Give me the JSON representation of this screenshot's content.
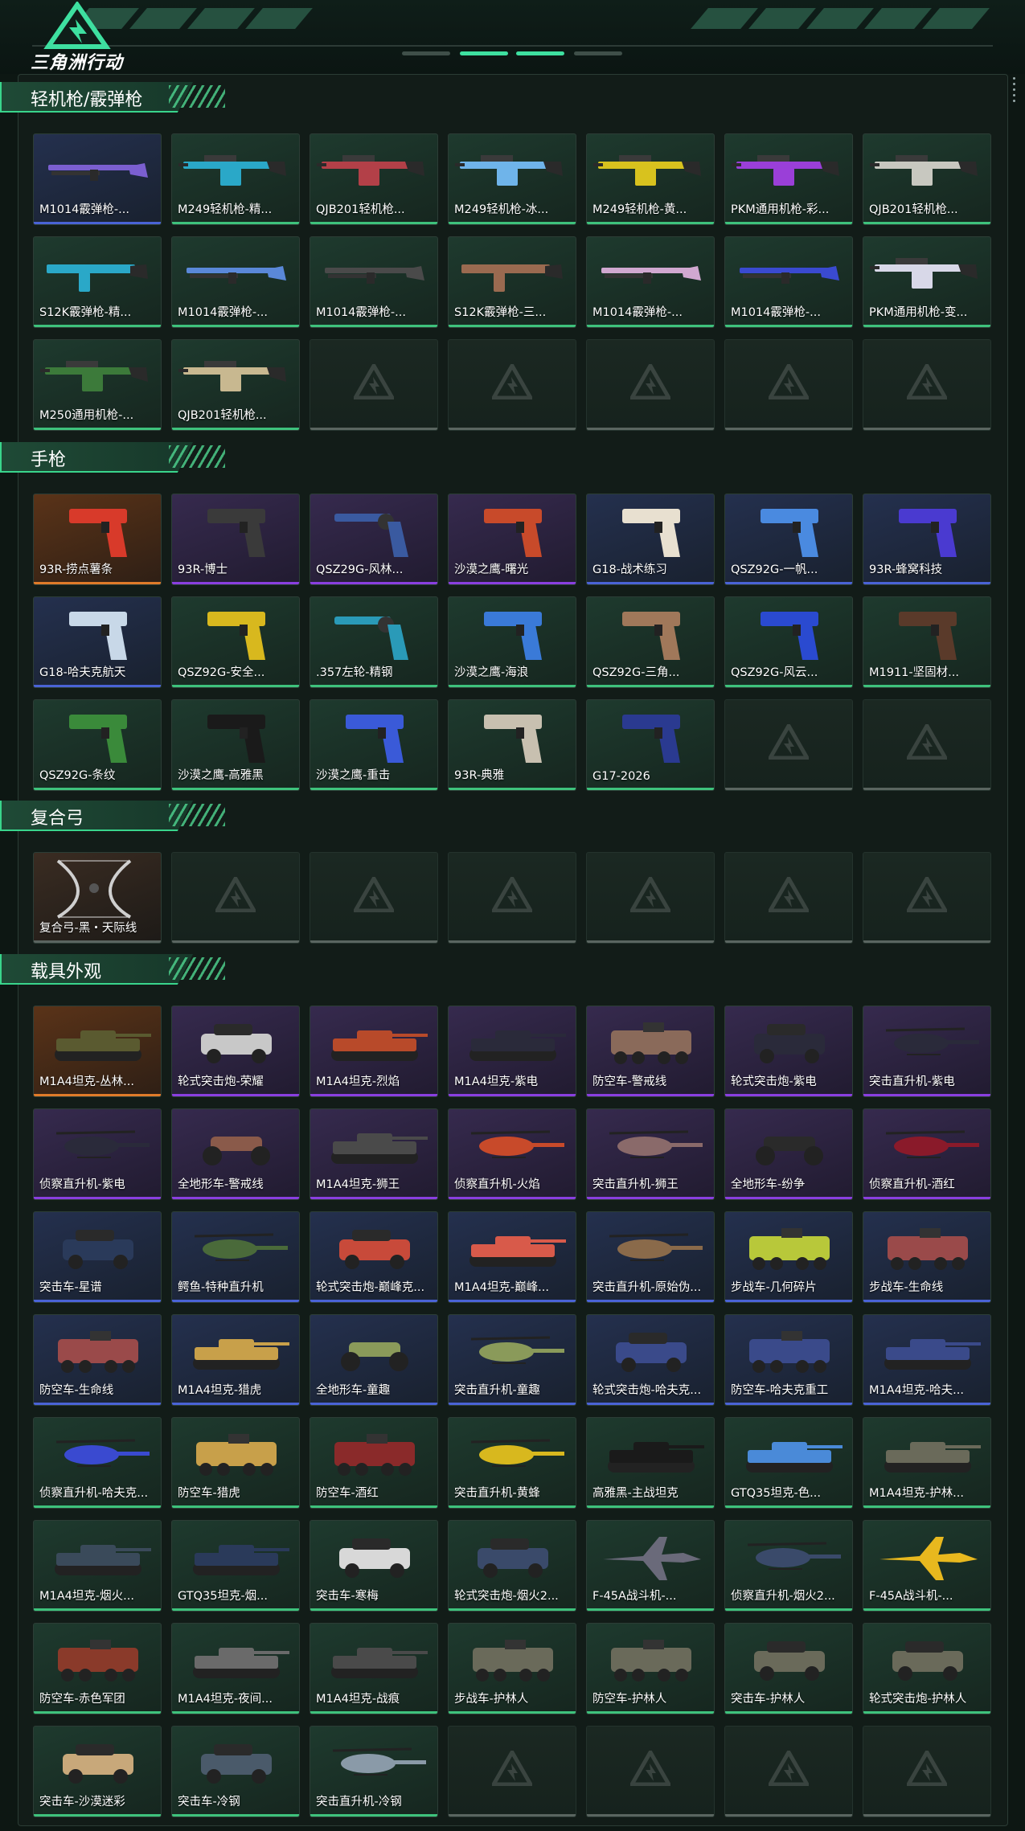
{
  "app": {
    "logo_text": "三角洲行动"
  },
  "theme": {
    "green": "#3ec27c",
    "blue": "#4a63d6",
    "purple": "#8a3fe0",
    "orange": "#e07b2a",
    "empty": "#5a6560"
  },
  "sections": [
    {
      "title": "轻机枪/霰弹枪",
      "items": [
        {
          "label": "M1014霰弹枪-...",
          "rarity": "blue",
          "type": "shotgun",
          "color": "#7b5fd0"
        },
        {
          "label": "M249轻机枪-精...",
          "rarity": "green",
          "type": "lmg",
          "color": "#2aa8c8"
        },
        {
          "label": "QJB201轻机枪...",
          "rarity": "green",
          "type": "lmg",
          "color": "#b34048"
        },
        {
          "label": "M249轻机枪-冰...",
          "rarity": "green",
          "type": "lmg",
          "color": "#6fb4ea"
        },
        {
          "label": "M249轻机枪-黄...",
          "rarity": "green",
          "type": "lmg",
          "color": "#d8c21e"
        },
        {
          "label": "PKM通用机枪-彩...",
          "rarity": "green",
          "type": "lmg",
          "color": "#9a3fd8"
        },
        {
          "label": "QJB201轻机枪...",
          "rarity": "green",
          "type": "lmg",
          "color": "#c8c8c0"
        },
        {
          "label": "S12K霰弹枪-精...",
          "rarity": "green",
          "type": "rifle",
          "color": "#2aa8c8"
        },
        {
          "label": "M1014霰弹枪-...",
          "rarity": "green",
          "type": "shotgun",
          "color": "#5a88d8"
        },
        {
          "label": "M1014霰弹枪-...",
          "rarity": "green",
          "type": "shotgun",
          "color": "#4a4a4a"
        },
        {
          "label": "S12K霰弹枪-三...",
          "rarity": "green",
          "type": "rifle",
          "color": "#9a6a50"
        },
        {
          "label": "M1014霰弹枪-...",
          "rarity": "green",
          "type": "shotgun",
          "color": "#d0a8d0"
        },
        {
          "label": "M1014霰弹枪-...",
          "rarity": "green",
          "type": "shotgun",
          "color": "#3a4ad0"
        },
        {
          "label": "PKM通用机枪-变...",
          "rarity": "green",
          "type": "lmg",
          "color": "#d8d8e8"
        },
        {
          "label": "M250通用机枪-...",
          "rarity": "green",
          "type": "lmg",
          "color": "#3c7a3a"
        },
        {
          "label": "QJB201轻机枪...",
          "rarity": "green",
          "type": "lmg",
          "color": "#c8b890"
        },
        {
          "empty": true
        },
        {
          "empty": true
        },
        {
          "empty": true
        },
        {
          "empty": true
        },
        {
          "empty": true
        }
      ]
    },
    {
      "title": "手枪",
      "items": [
        {
          "label": "93R-捞点薯条",
          "rarity": "orange",
          "type": "pistol",
          "color": "#d83a2a"
        },
        {
          "label": "93R-博士",
          "rarity": "purple",
          "type": "pistol",
          "color": "#3a3a3a"
        },
        {
          "label": "QSZ29G-风林...",
          "rarity": "purple",
          "type": "revolver",
          "color": "#3a5aa0"
        },
        {
          "label": "沙漠之鹰-曙光",
          "rarity": "purple",
          "type": "pistol",
          "color": "#c84a2a"
        },
        {
          "label": "G18-战术练习",
          "rarity": "blue",
          "type": "pistol",
          "color": "#e8e0d0"
        },
        {
          "label": "QSZ92G-一帆...",
          "rarity": "blue",
          "type": "pistol",
          "color": "#4a8ae0"
        },
        {
          "label": "93R-蜂窝科技",
          "rarity": "blue",
          "type": "pistol",
          "color": "#4a3ad0"
        },
        {
          "label": "G18-哈夫克航天",
          "rarity": "blue",
          "type": "pistol",
          "color": "#c8d8e8"
        },
        {
          "label": "QSZ92G-安全...",
          "rarity": "green",
          "type": "pistol",
          "color": "#d8b81e"
        },
        {
          "label": ".357左轮-精钢",
          "rarity": "green",
          "type": "revolver",
          "color": "#2a9ab8"
        },
        {
          "label": "沙漠之鹰-海浪",
          "rarity": "green",
          "type": "pistol",
          "color": "#3a7ad8"
        },
        {
          "label": "QSZ92G-三角...",
          "rarity": "green",
          "type": "pistol",
          "color": "#a0785a"
        },
        {
          "label": "QSZ92G-风云...",
          "rarity": "green",
          "type": "pistol",
          "color": "#2a4ad0"
        },
        {
          "label": "M1911-坚固材...",
          "rarity": "green",
          "type": "pistol",
          "color": "#5a3a2a"
        },
        {
          "label": "QSZ92G-条纹",
          "rarity": "green",
          "type": "pistol",
          "color": "#3a8a3a"
        },
        {
          "label": "沙漠之鹰-高雅黑",
          "rarity": "green",
          "type": "pistol",
          "color": "#1a1a1a"
        },
        {
          "label": "沙漠之鹰-重击",
          "rarity": "green",
          "type": "pistol",
          "color": "#3a5ad8"
        },
        {
          "label": "93R-典雅",
          "rarity": "green",
          "type": "pistol",
          "color": "#c8c0b0"
        },
        {
          "label": "G17-2026",
          "rarity": "green",
          "type": "pistol",
          "color": "#2a3a90"
        },
        {
          "empty": true
        },
        {
          "empty": true
        }
      ]
    },
    {
      "title": "复合弓",
      "items": [
        {
          "label": "复合弓-黑・天际线",
          "rarity": "empty",
          "type": "bow",
          "color": "#cfcfcf"
        },
        {
          "empty": true
        },
        {
          "empty": true
        },
        {
          "empty": true
        },
        {
          "empty": true
        },
        {
          "empty": true
        },
        {
          "empty": true
        }
      ]
    },
    {
      "title": "载具外观",
      "items": [
        {
          "label": "M1A4坦克-丛林...",
          "rarity": "orange",
          "type": "tank",
          "color": "#5a5a30"
        },
        {
          "label": "轮式突击炮-荣耀",
          "rarity": "purple",
          "type": "car",
          "color": "#c8c8c8"
        },
        {
          "label": "M1A4坦克-烈焰",
          "rarity": "purple",
          "type": "tank",
          "color": "#b84a2a"
        },
        {
          "label": "M1A4坦克-紫电",
          "rarity": "purple",
          "type": "tank",
          "color": "#2a2a3a"
        },
        {
          "label": "防空车-警戒线",
          "rarity": "purple",
          "type": "apc",
          "color": "#8a6a5a"
        },
        {
          "label": "轮式突击炮-紫电",
          "rarity": "purple",
          "type": "car",
          "color": "#2a2a3a"
        },
        {
          "label": "突击直升机-紫电",
          "rarity": "purple",
          "type": "heli",
          "color": "#2a2a3a"
        },
        {
          "label": "侦察直升机-紫电",
          "rarity": "purple",
          "type": "heli",
          "color": "#2a2a3a"
        },
        {
          "label": "全地形车-警戒线",
          "rarity": "purple",
          "type": "atv",
          "color": "#8a5a4a"
        },
        {
          "label": "M1A4坦克-狮王",
          "rarity": "purple",
          "type": "tank",
          "color": "#4a4a4a"
        },
        {
          "label": "侦察直升机-火焰",
          "rarity": "purple",
          "type": "heli",
          "color": "#c84a2a"
        },
        {
          "label": "突击直升机-狮王",
          "rarity": "purple",
          "type": "heli",
          "color": "#8a6a6a"
        },
        {
          "label": "全地形车-纷争",
          "rarity": "purple",
          "type": "atv",
          "color": "#2a2a2a"
        },
        {
          "label": "侦察直升机-酒红",
          "rarity": "purple",
          "type": "heli",
          "color": "#8a1a2a"
        },
        {
          "label": "突击车-星谱",
          "rarity": "blue",
          "type": "car",
          "color": "#2a3a5a"
        },
        {
          "label": "鳄鱼-特种直升机",
          "rarity": "blue",
          "type": "heli",
          "color": "#4a6a3a"
        },
        {
          "label": "轮式突击炮-巅峰克...",
          "rarity": "blue",
          "type": "car",
          "color": "#c84a3a"
        },
        {
          "label": "M1A4坦克-巅峰...",
          "rarity": "blue",
          "type": "tank",
          "color": "#d85a4a"
        },
        {
          "label": "突击直升机-原始伪...",
          "rarity": "blue",
          "type": "heli",
          "color": "#8a6a4a"
        },
        {
          "label": "步战车-几何碎片",
          "rarity": "blue",
          "type": "apc",
          "color": "#b8c83a"
        },
        {
          "label": "步战车-生命线",
          "rarity": "blue",
          "type": "apc",
          "color": "#9a4a4a"
        },
        {
          "label": "防空车-生命线",
          "rarity": "blue",
          "type": "apc",
          "color": "#9a4a4a"
        },
        {
          "label": "M1A4坦克-猎虎",
          "rarity": "blue",
          "type": "tank",
          "color": "#c8a04a"
        },
        {
          "label": "全地形车-童趣",
          "rarity": "blue",
          "type": "atv",
          "color": "#8a9a5a"
        },
        {
          "label": "突击直升机-童趣",
          "rarity": "blue",
          "type": "heli",
          "color": "#8a9a5a"
        },
        {
          "label": "轮式突击炮-哈夫克...",
          "rarity": "blue",
          "type": "car",
          "color": "#3a4a8a"
        },
        {
          "label": "防空车-哈夫克重工",
          "rarity": "blue",
          "type": "apc",
          "color": "#3a4a8a"
        },
        {
          "label": "M1A4坦克-哈夫...",
          "rarity": "blue",
          "type": "tank",
          "color": "#3a4a8a"
        },
        {
          "label": "侦察直升机-哈夫克...",
          "rarity": "green",
          "type": "heli",
          "color": "#3a4ad0"
        },
        {
          "label": "防空车-猎虎",
          "rarity": "green",
          "type": "apc",
          "color": "#c8a04a"
        },
        {
          "label": "防空车-酒红",
          "rarity": "green",
          "type": "apc",
          "color": "#8a2a2a"
        },
        {
          "label": "突击直升机-黄蜂",
          "rarity": "green",
          "type": "heli",
          "color": "#d8b81e"
        },
        {
          "label": "高雅黑-主战坦克",
          "rarity": "green",
          "type": "tank",
          "color": "#1a1a1a"
        },
        {
          "label": "GTQ35坦克-色...",
          "rarity": "green",
          "type": "tank",
          "color": "#4a8ad8"
        },
        {
          "label": "M1A4坦克-护林...",
          "rarity": "green",
          "type": "tank",
          "color": "#6a6a5a"
        },
        {
          "label": "M1A4坦克-烟火...",
          "rarity": "green",
          "type": "tank",
          "color": "#3a4a5a"
        },
        {
          "label": "GTQ35坦克-烟...",
          "rarity": "green",
          "type": "tank",
          "color": "#2a3a5a"
        },
        {
          "label": "突击车-寒梅",
          "rarity": "green",
          "type": "car",
          "color": "#d8d8d8"
        },
        {
          "label": "轮式突击炮-烟火2...",
          "rarity": "green",
          "type": "car",
          "color": "#3a4a6a"
        },
        {
          "label": "F-45A战斗机-...",
          "rarity": "green",
          "type": "jet",
          "color": "#6a6a7a"
        },
        {
          "label": "侦察直升机-烟火2...",
          "rarity": "green",
          "type": "heli",
          "color": "#3a4a6a"
        },
        {
          "label": "F-45A战斗机-...",
          "rarity": "green",
          "type": "jet",
          "color": "#e8b81e"
        },
        {
          "label": "防空车-赤色军团",
          "rarity": "green",
          "type": "apc",
          "color": "#8a3a2a"
        },
        {
          "label": "M1A4坦克-夜间...",
          "rarity": "green",
          "type": "tank",
          "color": "#6a6a6a"
        },
        {
          "label": "M1A4坦克-战痕",
          "rarity": "green",
          "type": "tank",
          "color": "#4a4a4a"
        },
        {
          "label": "步战车-护林人",
          "rarity": "green",
          "type": "apc",
          "color": "#6a6a5a"
        },
        {
          "label": "防空车-护林人",
          "rarity": "green",
          "type": "apc",
          "color": "#6a6a5a"
        },
        {
          "label": "突击车-护林人",
          "rarity": "green",
          "type": "car",
          "color": "#6a6a5a"
        },
        {
          "label": "轮式突击炮-护林人",
          "rarity": "green",
          "type": "car",
          "color": "#6a6a5a"
        },
        {
          "label": "突击车-沙漠迷彩",
          "rarity": "green",
          "type": "car",
          "color": "#c8a87a"
        },
        {
          "label": "突击车-冷钢",
          "rarity": "green",
          "type": "car",
          "color": "#4a5a6a"
        },
        {
          "label": "突击直升机-冷钢",
          "rarity": "green",
          "type": "heli",
          "color": "#8a9aa8"
        },
        {
          "empty": true
        },
        {
          "empty": true
        },
        {
          "empty": true
        },
        {
          "empty": true
        }
      ]
    }
  ]
}
